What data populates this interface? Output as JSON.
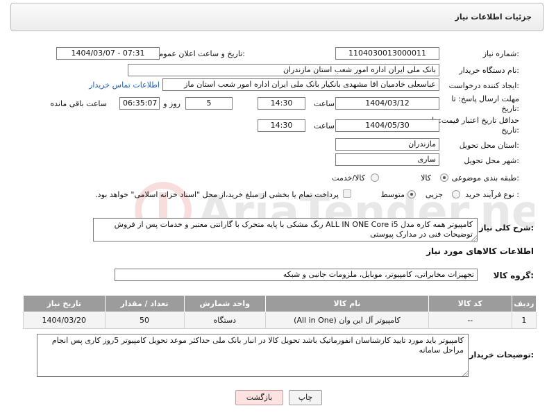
{
  "header": {
    "title": "جزئیات اطلاعات نیاز"
  },
  "fields": {
    "need_number_label": "شماره نیاز:",
    "need_number": "1104030013000011",
    "announce_label": "تاریخ و ساعت اعلان عمومی:",
    "announce_value": "1404/03/07 - 07:31",
    "buyer_org_label": "نام دستگاه خریدار:",
    "buyer_org": "بانک ملی ایران اداره امور شعب استان مازندران",
    "creator_label": "ایجاد کننده درخواست:",
    "creator": "عباسعلی خادمیان اقا مشهدی بانکیار بانک ملی ایران اداره امور شعب استان ماز",
    "contact_link": "اطلاعات تماس خریدار",
    "deadline_label": "مهلت ارسال پاسخ: تا تاریخ:",
    "deadline_date": "1404/03/12",
    "time_label": "ساعت",
    "deadline_time": "14:30",
    "days_count": "5",
    "days_label": "روز و",
    "remaining_time": "06:35:07",
    "remaining_label": "ساعت باقی مانده",
    "price_validity_label": "حداقل تاریخ اعتبار قیمت: تا تاریخ:",
    "price_validity_date": "1404/05/30",
    "price_validity_time": "14:30",
    "province_label": "استان محل تحویل:",
    "province": "مازندران",
    "city_label": "شهر محل تحویل:",
    "city": "ساری",
    "category_label": "طبقه بندی موضوعی:",
    "category_options": [
      "کالا",
      "کالا/خدمت"
    ],
    "process_label": "نوع فرآیند خرید :",
    "process_options": [
      "جزیی",
      "متوسط"
    ],
    "payment_note": "پرداخت تمام یا بخشی از مبلغ خرید،از محل \"اسناد خزانه اسلامی\" خواهد بود."
  },
  "description": {
    "label": "شرح کلی نیاز:",
    "text": "کامپیوتر همه کاره مدل ALL IN ONE Core i5 رنگ مشکی با پایه متحرک با گارانتی معتبر و خدمات پس از فروش توضیحات فنی در مدارک پیوستی"
  },
  "goods": {
    "section_title": "اطلاعات کالاهای مورد نیاز",
    "group_label": "گروه کالا:",
    "group_value": "تجهیزات مخابراتی، کامپیوتر، موبایل، ملزومات جانبی و شبکه",
    "columns": [
      "ردیف",
      "کد کالا",
      "نام کالا",
      "واحد شمارش",
      "تعداد / مقدار",
      "تاریخ نیاز"
    ],
    "rows": [
      {
        "row": "1",
        "code": "--",
        "name": "کامپیوتر آل این وان (All in One)",
        "unit": "دستگاه",
        "qty": "50",
        "date": "1404/03/20"
      }
    ]
  },
  "buyer_notes": {
    "label": "توضیحات خریدار:",
    "text": "کامپیوتر باید مورد تایید کارشناسان انفورماتیک باشد تحویل کالا در انبار بانک ملی حداکثر موعد تحویل کامپیوتر 5روز کاری پس انجام مراحل سامانه"
  },
  "buttons": {
    "print": "چاپ",
    "back": "بازگشت"
  },
  "watermark_text": "AriaTender.net"
}
